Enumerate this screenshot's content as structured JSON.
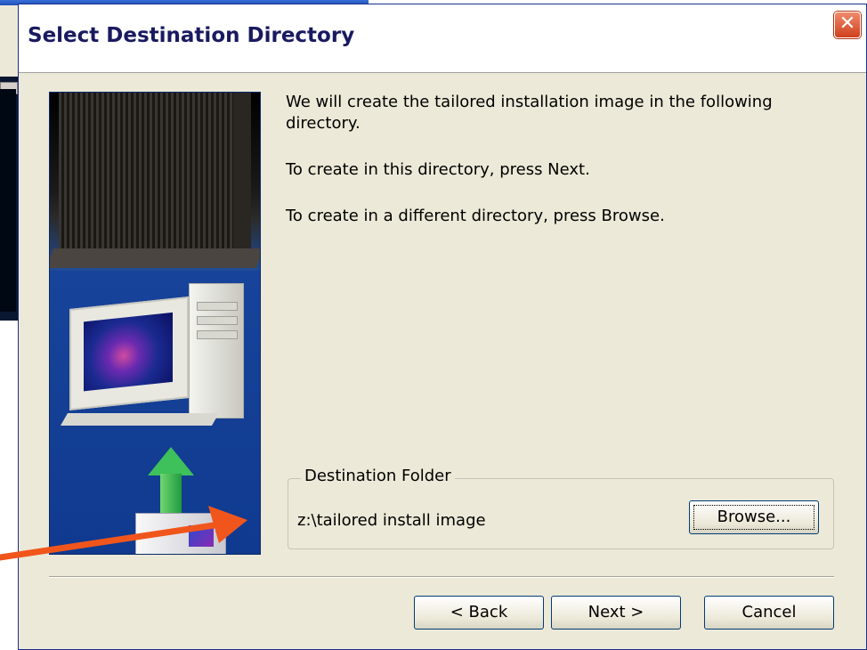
{
  "dialog": {
    "title": "Select Destination Directory",
    "close_glyph": "✕"
  },
  "intro": {
    "line1": "We will create the tailored installation image in the following directory.",
    "line2": "To create in this directory, press Next.",
    "line3": "To create in a different directory, press Browse."
  },
  "destination": {
    "group_label": "Destination Folder",
    "path": "z:\\tailored install image",
    "browse_label": "Browse..."
  },
  "buttons": {
    "back": "< Back",
    "next": "Next >",
    "cancel": "Cancel"
  },
  "colors": {
    "annotation_arrow": "#f0561c",
    "dialog_face": "#ece9d8",
    "title_text": "#1a1a60"
  }
}
